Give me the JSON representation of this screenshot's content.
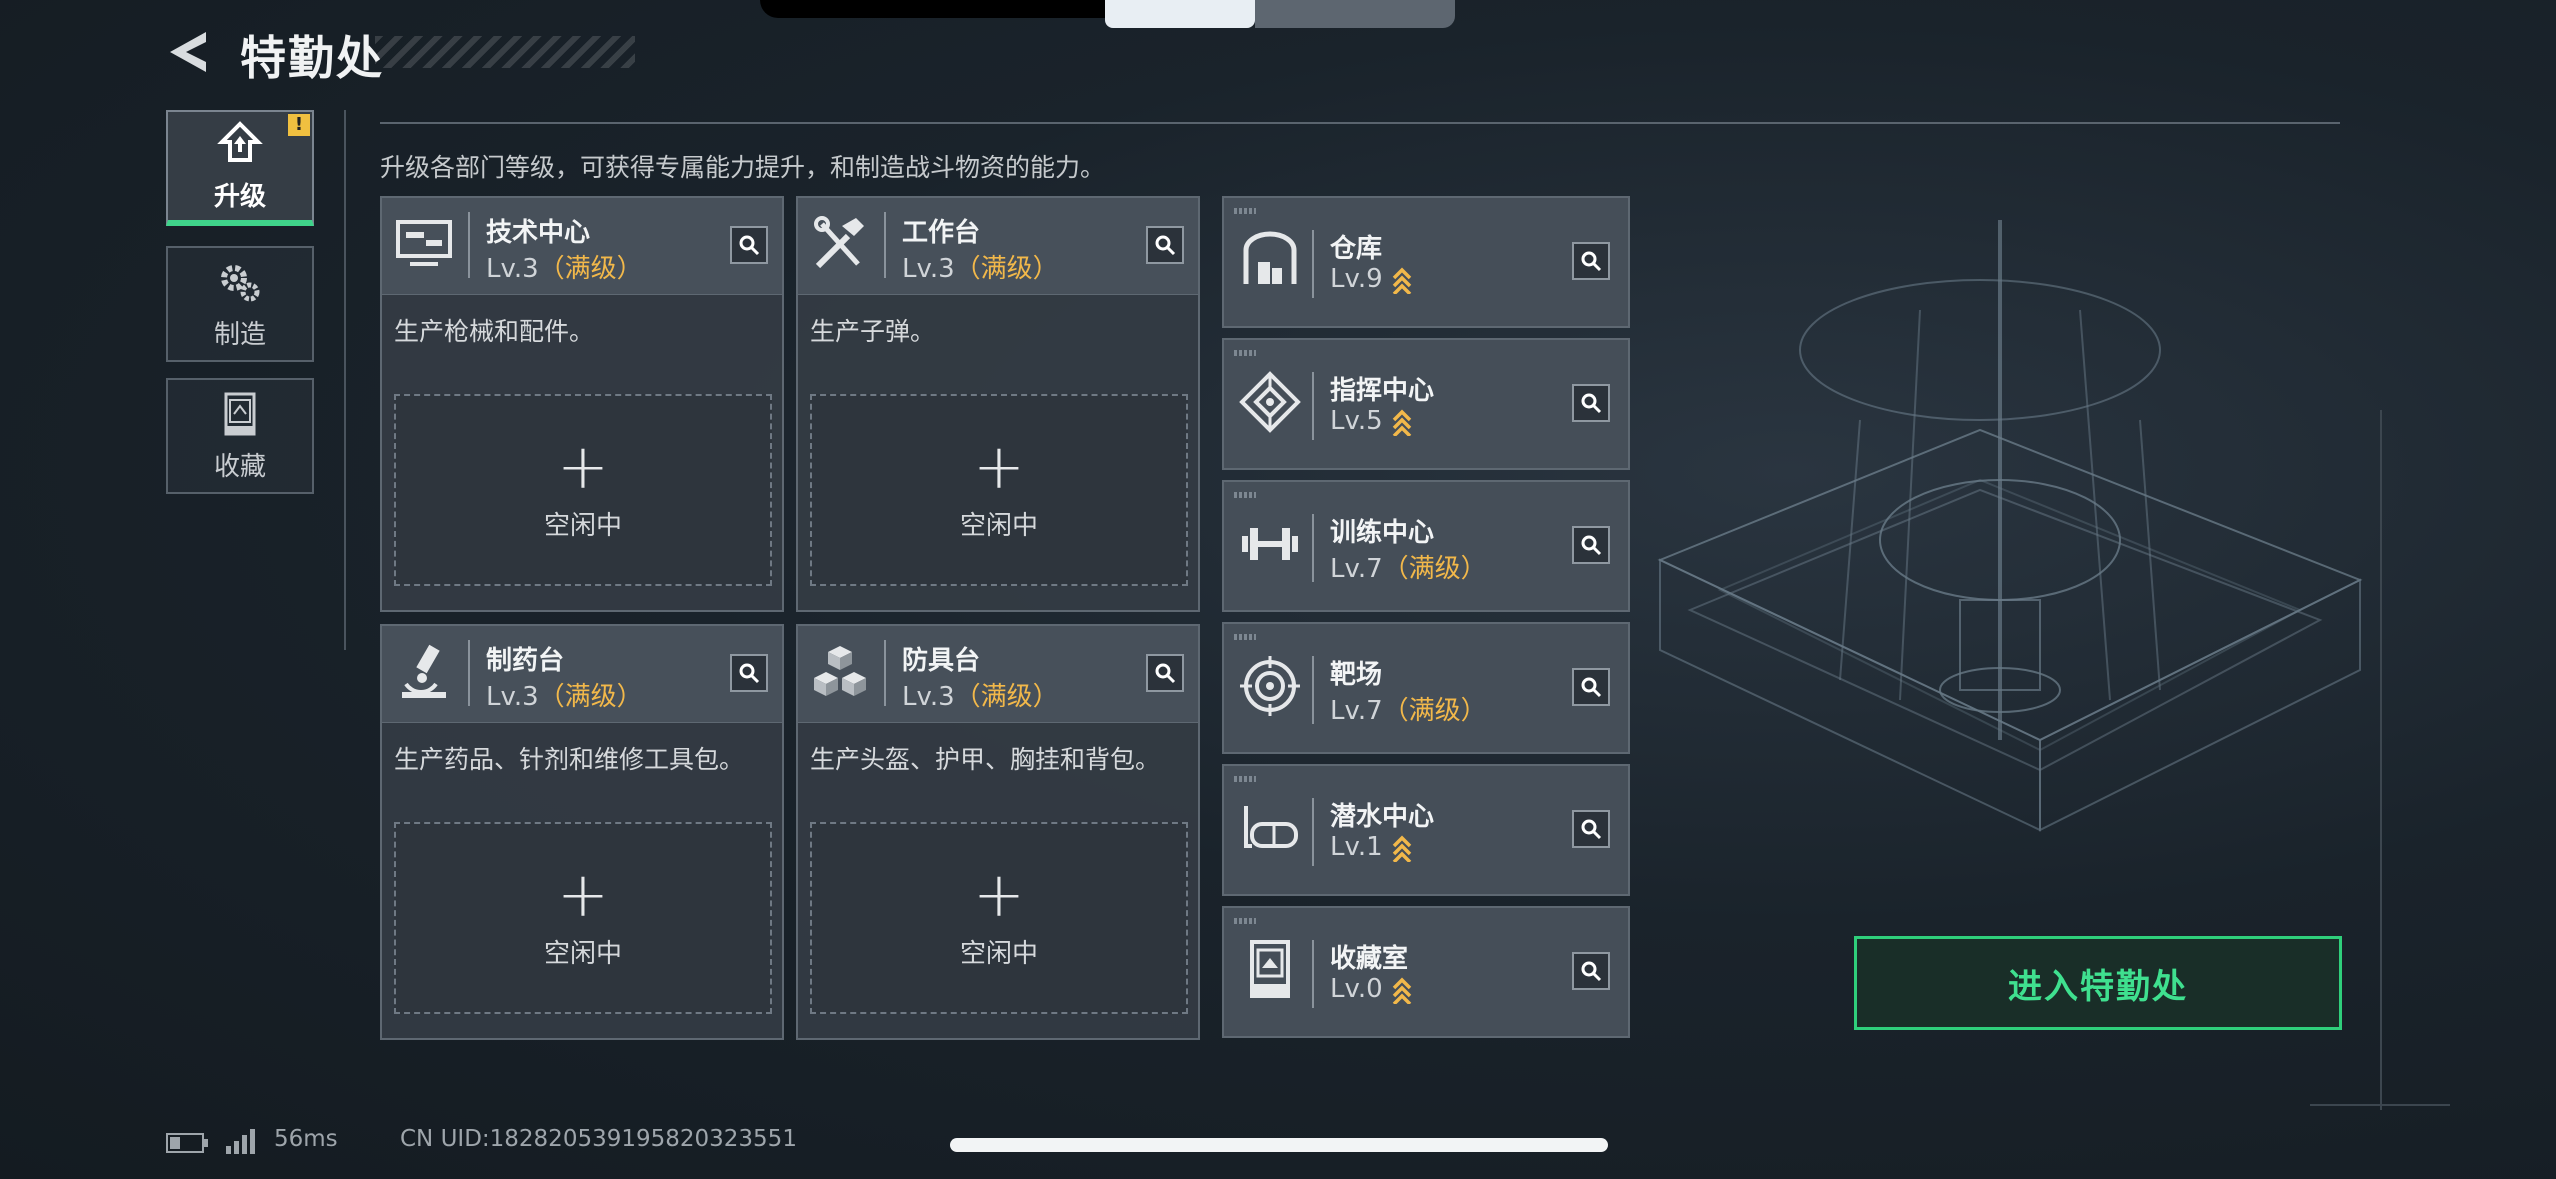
{
  "header": {
    "title": "特勤处"
  },
  "tabs": [
    {
      "label": "升级",
      "icon": "upgrade-icon",
      "active": true,
      "badge": "!"
    },
    {
      "label": "制造",
      "icon": "gears-icon",
      "active": false
    },
    {
      "label": "收藏",
      "icon": "collection-icon",
      "active": false
    }
  ],
  "description": "升级各部门等级，可获得专属能力提升，和制造战斗物资的能力。",
  "departments": [
    {
      "name": "技术中心",
      "level": "Lv.3",
      "status": "（满级）",
      "desc": "生产枪械和配件。",
      "slot_label": "空闲中",
      "icon": "computer-icon"
    },
    {
      "name": "工作台",
      "level": "Lv.3",
      "status": "（满级）",
      "desc": "生产子弹。",
      "slot_label": "空闲中",
      "icon": "tools-icon"
    },
    {
      "name": "制药台",
      "level": "Lv.3",
      "status": "（满级）",
      "desc": "生产药品、针剂和维修工具包。",
      "slot_label": "空闲中",
      "icon": "microscope-icon"
    },
    {
      "name": "防具台",
      "level": "Lv.3",
      "status": "（满级）",
      "desc": "生产头盔、护甲、胸挂和背包。",
      "slot_label": "空闲中",
      "icon": "cubes-icon"
    }
  ],
  "facilities": [
    {
      "name": "仓库",
      "level": "Lv.9",
      "status": "",
      "upgradable": true,
      "icon": "warehouse-icon"
    },
    {
      "name": "指挥中心",
      "level": "Lv.5",
      "status": "",
      "upgradable": true,
      "icon": "command-icon"
    },
    {
      "name": "训练中心",
      "level": "Lv.7",
      "status": "（满级）",
      "upgradable": false,
      "icon": "dumbbell-icon"
    },
    {
      "name": "靶场",
      "level": "Lv.7",
      "status": "（满级）",
      "upgradable": false,
      "icon": "target-icon"
    },
    {
      "name": "潜水中心",
      "level": "Lv.1",
      "status": "",
      "upgradable": true,
      "icon": "diving-mask-icon"
    },
    {
      "name": "收藏室",
      "level": "Lv.0",
      "status": "",
      "upgradable": true,
      "icon": "display-case-icon"
    }
  ],
  "enter_button": "进入特勤处",
  "footer": {
    "ping": "56ms",
    "uid": "CN UID:182820539195820323551"
  },
  "colors": {
    "accent_green": "#3fe08f",
    "maxed_gold": "#f2b84a"
  }
}
